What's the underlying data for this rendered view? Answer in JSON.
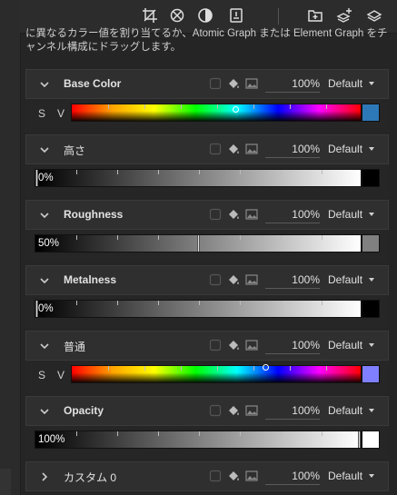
{
  "description": "に異なるカラー値を割り当てるか、Atomic Graph または Element Graph をチャンネル構成にドラッグします。",
  "toolbar": {
    "icons": [
      "crop-icon",
      "symmetry-icon",
      "contrast-icon",
      "export-icon",
      "add-layer-icon",
      "add-fill-layer-icon",
      "layers-icon"
    ]
  },
  "channels": [
    {
      "name": "Base Color",
      "type": "color",
      "percent": "100%",
      "mode": "Default",
      "sv": [
        "S",
        "V"
      ],
      "swatch_color": "#2d79b8",
      "expanded": true
    },
    {
      "name": "高さ",
      "type": "gray",
      "percent": "100%",
      "mode": "Default",
      "value": "0%",
      "level": 0.0,
      "expanded": true
    },
    {
      "name": "Roughness",
      "type": "gray",
      "percent": "100%",
      "mode": "Default",
      "value": "50%",
      "level": 0.5,
      "expanded": true
    },
    {
      "name": "Metalness",
      "type": "gray",
      "percent": "100%",
      "mode": "Default",
      "value": "0%",
      "level": 0.0,
      "expanded": true
    },
    {
      "name": "普通",
      "type": "color",
      "percent": "100%",
      "mode": "Default",
      "sv": [
        "S",
        "V"
      ],
      "swatch_color": "#7f7fff",
      "expanded": true
    },
    {
      "name": "Opacity",
      "type": "gray",
      "percent": "100%",
      "mode": "Default",
      "value": "100%",
      "level": 1.0,
      "expanded": true
    },
    {
      "name": "カスタム 0",
      "type": "none",
      "percent": "100%",
      "mode": "Default",
      "expanded": false
    }
  ]
}
